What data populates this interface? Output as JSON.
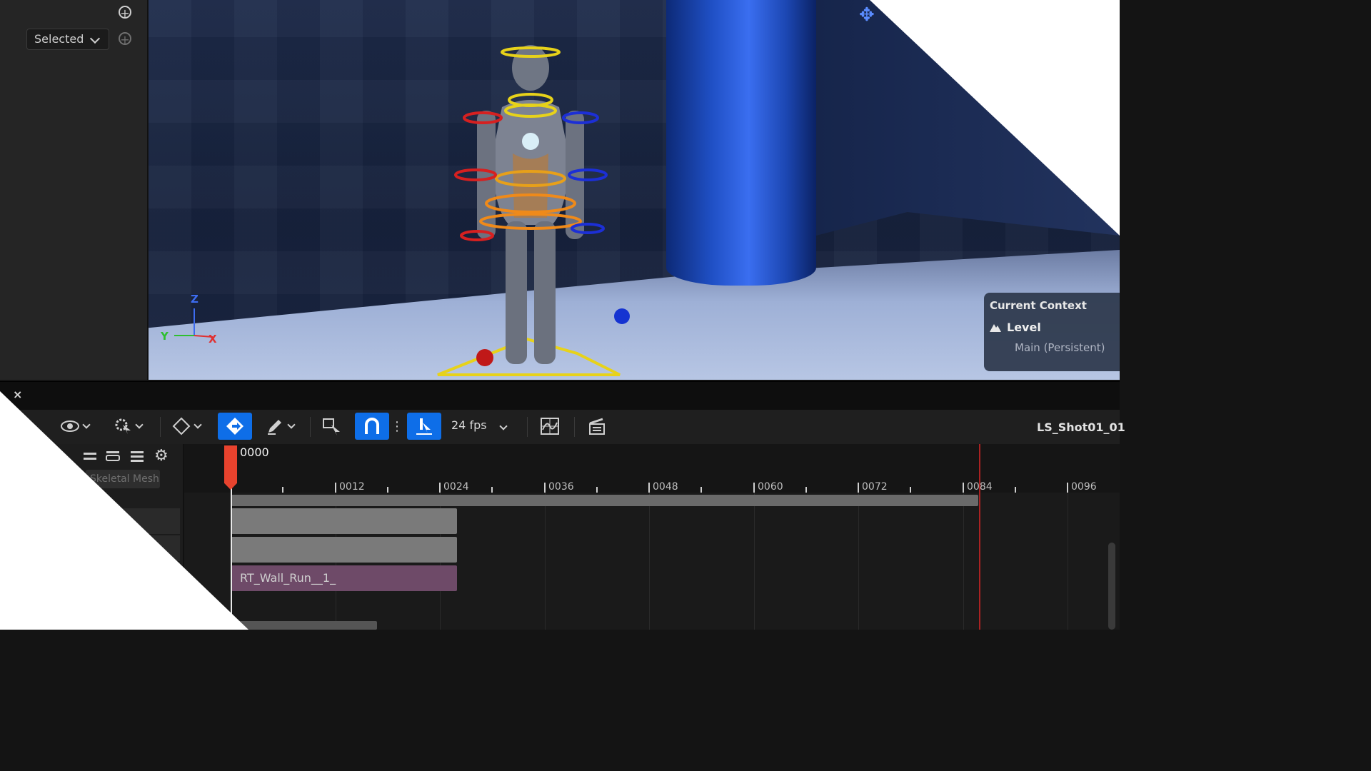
{
  "outliner": {
    "filter_label": "Selected",
    "add_icon": "plus-circle-icon"
  },
  "viewport": {
    "axis": {
      "z": "Z",
      "y": "Y",
      "x": "X"
    },
    "context": {
      "title": "Current Context",
      "level_label": "Level",
      "level_value": "Main (Persistent)"
    }
  },
  "sequencer": {
    "close_label": "×",
    "fps_label": "24 fps",
    "sequence_name": "LS_Shot01_01",
    "current_frame": "0000",
    "skeletal_tag": "Skeletal Mesh",
    "ruler_labels": [
      "0012",
      "0024",
      "0036",
      "0048",
      "0060",
      "0072",
      "0084",
      "0096"
    ],
    "sections": {
      "anim_label": "RT_Wall_Run__1_"
    }
  },
  "colors": {
    "accent": "#0e6ee8",
    "playhead": "#e8432e",
    "anim_section": "#6e4a68"
  }
}
